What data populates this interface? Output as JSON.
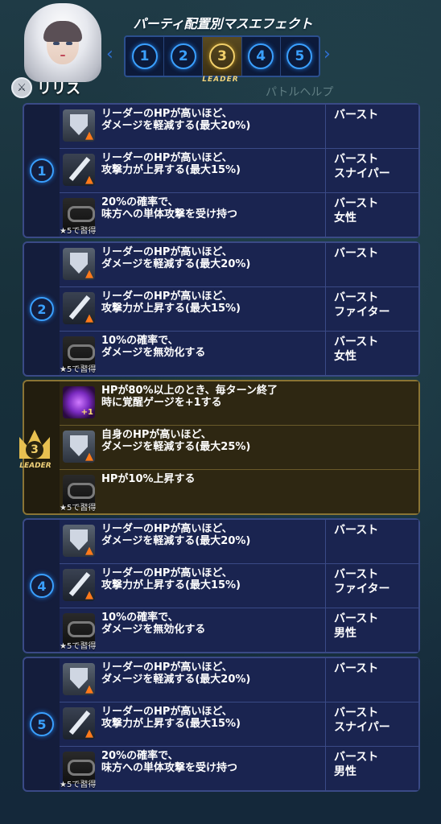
{
  "header": {
    "title": "パーティ配置別マスエフェクト",
    "leader_label": "LEADER",
    "positions": [
      "1",
      "2",
      "3",
      "4",
      "5"
    ],
    "active_position": "3",
    "character_name": "リリス",
    "background_text": "パトルヘルプ",
    "background_name": "リリス"
  },
  "lock_note": "★5で習得",
  "groups": [
    {
      "label": "1",
      "leader": false,
      "rows": [
        {
          "icon": "shield-up-icon",
          "desc": [
            "リーダーのHPが高いほど、",
            "ダメージを軽減する(最大20%)"
          ],
          "cond": [
            "バースト"
          ],
          "locked": false
        },
        {
          "icon": "sword-up-icon",
          "desc": [
            "リーダーのHPが高いほど、",
            "攻撃力が上昇する(最大15%)"
          ],
          "cond": [
            "バースト",
            "スナイパー"
          ],
          "locked": false
        },
        {
          "icon": "chain-icon",
          "desc": [
            "20%の確率で、",
            "味方への単体攻撃を受け持つ"
          ],
          "cond": [
            "バースト",
            "女性"
          ],
          "locked": true
        }
      ]
    },
    {
      "label": "2",
      "leader": false,
      "rows": [
        {
          "icon": "shield-up-icon",
          "desc": [
            "リーダーのHPが高いほど、",
            "ダメージを軽減する(最大20%)"
          ],
          "cond": [
            "バースト"
          ],
          "locked": false
        },
        {
          "icon": "sword-up-icon",
          "desc": [
            "リーダーのHPが高いほど、",
            "攻撃力が上昇する(最大15%)"
          ],
          "cond": [
            "バースト",
            "ファイター"
          ],
          "locked": false
        },
        {
          "icon": "chain-icon",
          "desc": [
            "10%の確率で、",
            "ダメージを無効化する"
          ],
          "cond": [
            "バースト",
            "女性"
          ],
          "locked": true
        }
      ]
    },
    {
      "label": "3",
      "leader": true,
      "leader_label": "LEADER",
      "rows": [
        {
          "icon": "awaken-orb-icon",
          "desc": [
            "HPが80%以上のとき、毎ターン終了",
            "時に覚醒ゲージを+1する"
          ],
          "cond": [],
          "locked": false
        },
        {
          "icon": "shield-up-icon",
          "desc": [
            "自身のHPが高いほど、",
            "ダメージを軽減する(最大25%)"
          ],
          "cond": [],
          "locked": false
        },
        {
          "icon": "chain-icon",
          "desc": [
            "HPが10%上昇する"
          ],
          "cond": [],
          "locked": true
        }
      ]
    },
    {
      "label": "4",
      "leader": false,
      "rows": [
        {
          "icon": "shield-up-icon",
          "desc": [
            "リーダーのHPが高いほど、",
            "ダメージを軽減する(最大20%)"
          ],
          "cond": [
            "バースト"
          ],
          "locked": false
        },
        {
          "icon": "sword-up-icon",
          "desc": [
            "リーダーのHPが高いほど、",
            "攻撃力が上昇する(最大15%)"
          ],
          "cond": [
            "バースト",
            "ファイター"
          ],
          "locked": false
        },
        {
          "icon": "chain-icon",
          "desc": [
            "10%の確率で、",
            "ダメージを無効化する"
          ],
          "cond": [
            "バースト",
            "男性"
          ],
          "locked": true
        }
      ]
    },
    {
      "label": "5",
      "leader": false,
      "rows": [
        {
          "icon": "shield-up-icon",
          "desc": [
            "リーダーのHPが高いほど、",
            "ダメージを軽減する(最大20%)"
          ],
          "cond": [
            "バースト"
          ],
          "locked": false
        },
        {
          "icon": "sword-up-icon",
          "desc": [
            "リーダーのHPが高いほど、",
            "攻撃力が上昇する(最大15%)"
          ],
          "cond": [
            "バースト",
            "スナイパー"
          ],
          "locked": false
        },
        {
          "icon": "chain-icon",
          "desc": [
            "20%の確率で、",
            "味方への単体攻撃を受け持つ"
          ],
          "cond": [
            "バースト",
            "男性"
          ],
          "locked": true
        }
      ]
    }
  ]
}
